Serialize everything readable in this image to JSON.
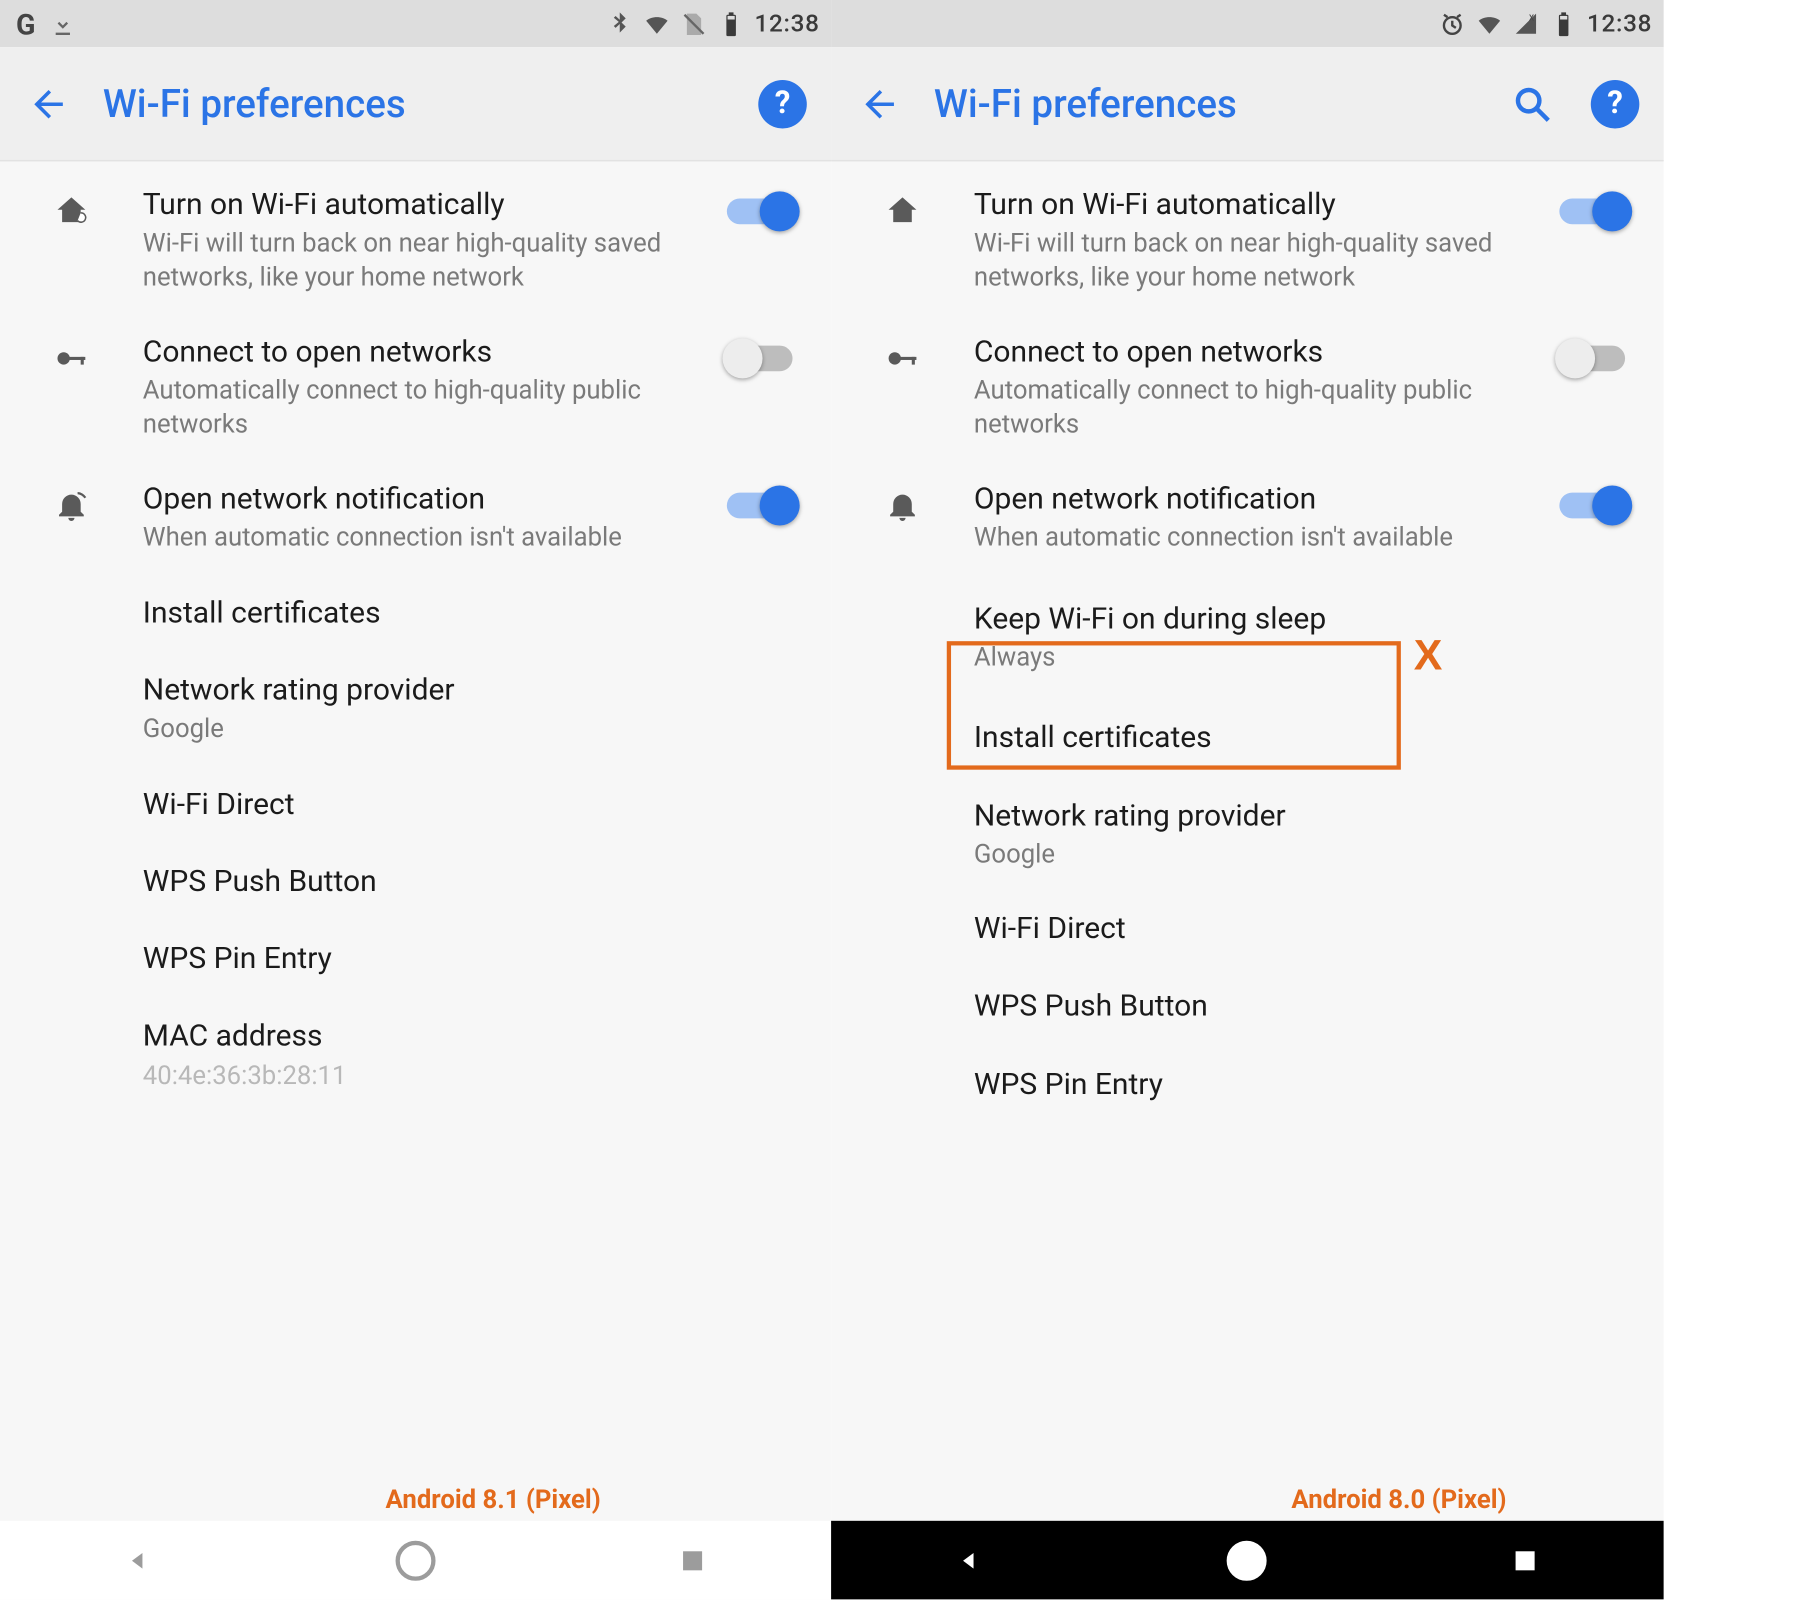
{
  "left": {
    "status": {
      "clock": "12:38",
      "has_bt": true,
      "has_alarm": false,
      "has_google": true
    },
    "appbar": {
      "title": "Wi-Fi preferences",
      "has_search": false
    },
    "items": [
      {
        "icon": "home-sync",
        "title": "Turn on Wi-Fi automatically",
        "sub": "Wi-Fi will turn back on near high-quality saved networks, like your home network",
        "switch": "on"
      },
      {
        "icon": "key",
        "title": "Connect to open networks",
        "sub": "Automatically connect to high-quality public networks",
        "switch": "off"
      },
      {
        "icon": "bell-wifi",
        "title": "Open network notification",
        "sub": "When automatic connection isn't available",
        "switch": "on"
      },
      {
        "title": "Install certificates"
      },
      {
        "title": "Network rating provider",
        "sub": "Google"
      },
      {
        "title": "Wi-Fi Direct"
      },
      {
        "title": "WPS Push Button"
      },
      {
        "title": "WPS Pin Entry"
      },
      {
        "title": "MAC address",
        "sub": "40:4e:36:3b:28:11"
      }
    ],
    "version_label": "Android 8.1 (Pixel)",
    "nav_theme": "light"
  },
  "right": {
    "status": {
      "clock": "12:38",
      "has_bt": false,
      "has_alarm": true,
      "has_google": false
    },
    "appbar": {
      "title": "Wi-Fi preferences",
      "has_search": true
    },
    "items": [
      {
        "icon": "home-sync",
        "title": "Turn on Wi-Fi automatically",
        "sub": "Wi-Fi will turn back on near high-quality saved networks, like your home network",
        "switch": "on"
      },
      {
        "icon": "key",
        "title": "Connect to open networks",
        "sub": "Automatically connect to high-quality public networks",
        "switch": "off"
      },
      {
        "icon": "bell-wifi",
        "title": "Open network notification",
        "sub": "When automatic connection isn't available",
        "switch": "on"
      },
      {
        "title": "Keep Wi-Fi on during sleep",
        "sub": "Always",
        "highlight": true
      },
      {
        "title": "Install certificates"
      },
      {
        "title": "Network rating provider",
        "sub": "Google"
      },
      {
        "title": "Wi-Fi Direct"
      },
      {
        "title": "WPS Push Button"
      },
      {
        "title": "WPS Pin Entry"
      }
    ],
    "highlight_marker": "X",
    "version_label": "Android 8.0 (Pixel)",
    "nav_theme": "dark"
  }
}
